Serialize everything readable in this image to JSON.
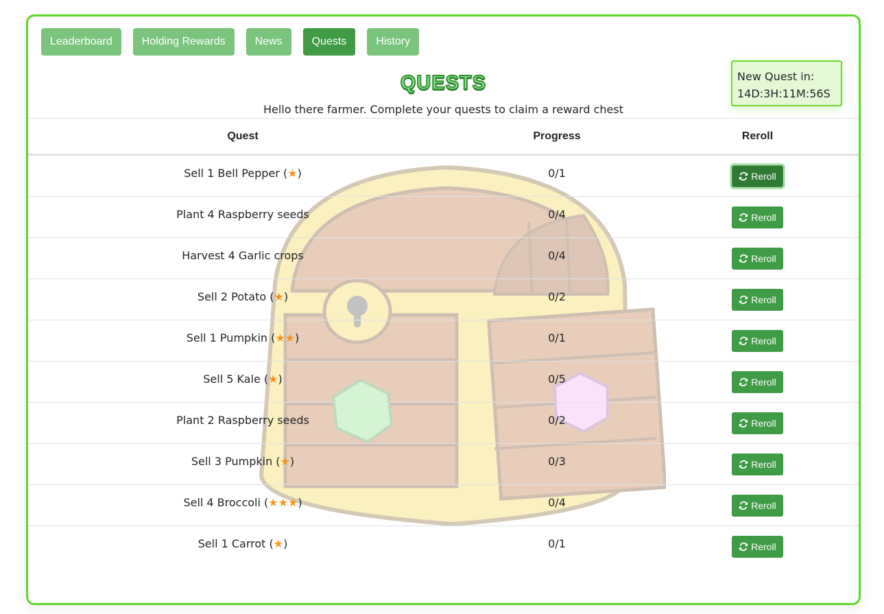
{
  "tabs": [
    {
      "label": "Leaderboard",
      "active": false
    },
    {
      "label": "Holding Rewards",
      "active": false
    },
    {
      "label": "News",
      "active": false
    },
    {
      "label": "Quests",
      "active": true
    },
    {
      "label": "History",
      "active": false
    }
  ],
  "timer": {
    "label": "New Quest in:",
    "value": "14D:3H:11M:56S"
  },
  "header": {
    "title": "QUESTS",
    "subtitle": "Hello there farmer. Complete your quests to claim a reward chest"
  },
  "table": {
    "columns": [
      "Quest",
      "Progress",
      "Reroll"
    ],
    "reroll_label": "Reroll",
    "rows": [
      {
        "quest": "Sell 1 Bell Pepper",
        "stars": 1,
        "progress": "0/1"
      },
      {
        "quest": "Plant 4 Raspberry seeds",
        "stars": 0,
        "progress": "0/4"
      },
      {
        "quest": "Harvest 4 Garlic crops",
        "stars": 0,
        "progress": "0/4"
      },
      {
        "quest": "Sell 2 Potato",
        "stars": 1,
        "progress": "0/2"
      },
      {
        "quest": "Sell 1 Pumpkin",
        "stars": 2,
        "progress": "0/1"
      },
      {
        "quest": "Sell 5 Kale",
        "stars": 1,
        "progress": "0/5"
      },
      {
        "quest": "Plant 2 Raspberry seeds",
        "stars": 0,
        "progress": "0/2"
      },
      {
        "quest": "Sell 3 Pumpkin",
        "stars": 1,
        "progress": "0/3"
      },
      {
        "quest": "Sell 4 Broccoli",
        "stars": 3,
        "progress": "0/4"
      },
      {
        "quest": "Sell 1 Carrot",
        "stars": 1,
        "progress": "0/1"
      }
    ]
  },
  "icons": {
    "star": "star-icon",
    "reroll": "sync-icon",
    "background": "treasure-chest-image"
  },
  "colors": {
    "accent": "#3f9b45",
    "tab_inactive": "#7ac47e",
    "border": "#5fd62a",
    "star": "#f7931e"
  }
}
